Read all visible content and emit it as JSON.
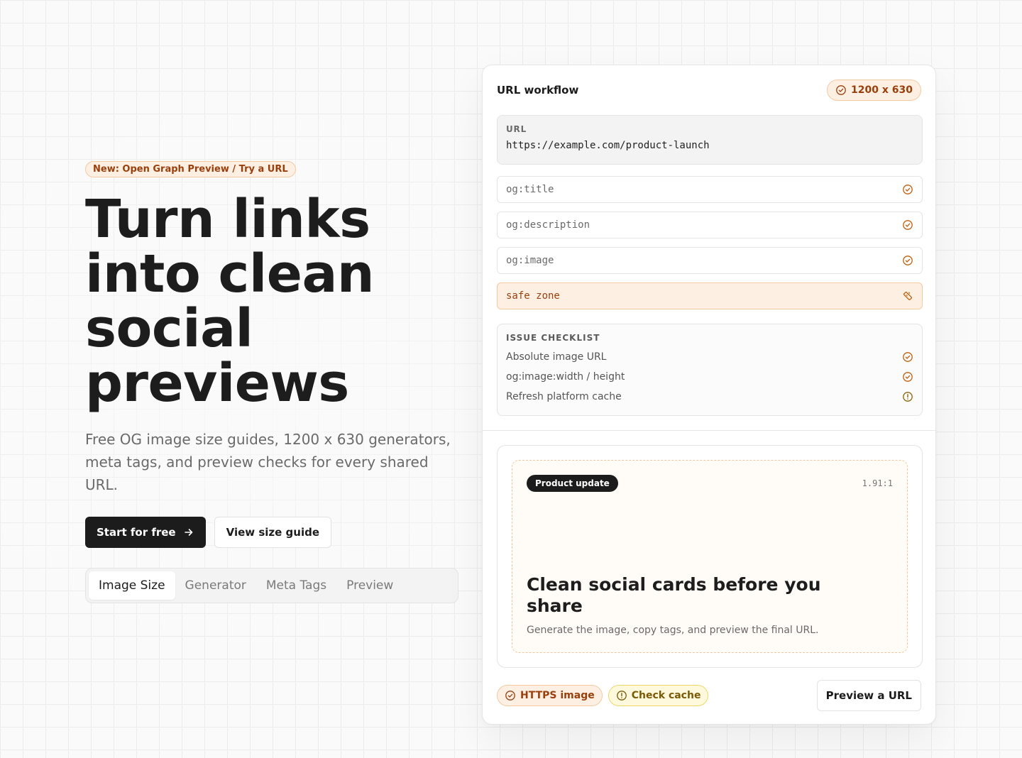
{
  "hero": {
    "announcement": "New: Open Graph Preview / Try a URL",
    "headline": "Turn links into clean social previews",
    "subtext": "Free OG image size guides, 1200 x 630 generators, meta tags, and preview checks for every shared URL.",
    "cta_primary": "Start for free",
    "cta_secondary": "View size guide",
    "tabs": [
      "Image Size",
      "Generator",
      "Meta Tags",
      "Preview"
    ],
    "active_tab": "Image Size"
  },
  "panel": {
    "title": "URL workflow",
    "size_badge": "1200 x 630",
    "url_label": "URL",
    "url_value": "https://example.com/product-launch",
    "fields": [
      "og:title",
      "og:description",
      "og:image",
      "safe zone"
    ],
    "checklist": {
      "title": "ISSUE CHECKLIST",
      "items": [
        "Absolute image URL",
        "og:image:width / height",
        "Refresh platform cache"
      ]
    },
    "preview": {
      "tag": "Product update",
      "ratio": "1.91:1",
      "title": "Clean social cards before you share",
      "description": "Generate the image, copy tags, and preview the final URL."
    },
    "chips": [
      "HTTPS image",
      "Check cache"
    ],
    "action_button": "Preview a URL"
  },
  "colors": {
    "accent": "#c0600f",
    "accent_bg": "#fdf0e3",
    "warning": "#b8860b",
    "dark": "#1c1c1c"
  },
  "icons": {
    "check": "check-circle-icon",
    "alert": "alert-circle-icon",
    "ruler": "ruler-icon",
    "arrow": "arrow-right-icon"
  }
}
